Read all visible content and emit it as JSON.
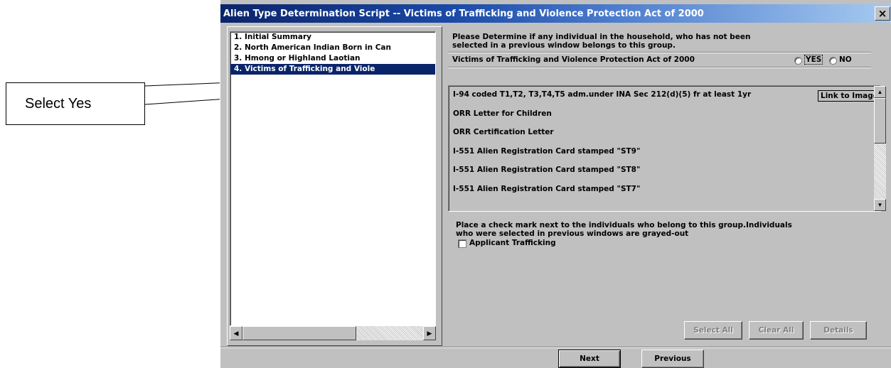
{
  "callout": {
    "text": "Select Yes"
  },
  "window": {
    "title": "Alien Type Determination Script -- Victims of Trafficking and Violence Protection Act of 2000",
    "close_label": "×"
  },
  "steps": [
    {
      "num": "1.",
      "label": "Initial Summary"
    },
    {
      "num": "2.",
      "label": "North American Indian Born in Can"
    },
    {
      "num": "3.",
      "label": "Hmong or Highland Laotian"
    },
    {
      "num": "4.",
      "label": "Victims of Trafficking and Viole"
    }
  ],
  "selected_step": 4,
  "instructions": {
    "line1": "Please Determine if any individual in the household, who has not been",
    "line2": "selected in a previous window belongs to this group."
  },
  "group": {
    "label": "Victims of Trafficking and Violence Protection Act of 2000",
    "yes_label": "YES",
    "no_label": "NO",
    "selected": "none"
  },
  "documents": [
    "I-94 coded T1,T2, T3,T4,T5 adm.under INA Sec 212(d)(5) fr at least 1yr",
    "ORR Letter for Children",
    "ORR Certification Letter",
    "I-551 Alien Registration Card stamped \"ST9\"",
    "I-551 Alien Registration Card stamped \"ST8\"",
    "I-551 Alien Registration Card stamped \"ST7\""
  ],
  "link_to_image_label": "Link to Image",
  "check_instructions": {
    "line1": "Place a check mark next to the individuals who belong to this group.Individuals",
    "line2": "who were selected in previous windows are grayed-out"
  },
  "individuals": [
    {
      "label": "Applicant Trafficking",
      "checked": false
    }
  ],
  "buttons": {
    "select_all": "Select All",
    "clear_all": "Clear All",
    "details": "Details",
    "next": "Next",
    "previous": "Previous"
  },
  "scroll_arrows": {
    "left": "◀",
    "right": "▶",
    "up": "▲",
    "down": "▼"
  }
}
